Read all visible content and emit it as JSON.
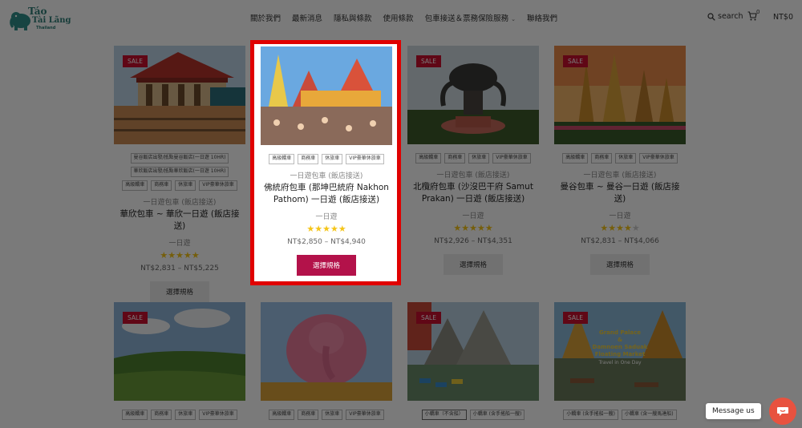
{
  "brand": {
    "line1": "Táo",
    "line1b": "Tài Lãng",
    "line2": "Thailand"
  },
  "nav": {
    "items": [
      "關於我們",
      "最新消息",
      "隱私與條款",
      "使用條款",
      "包車接送＆票務保險服務",
      "聯絡我們"
    ],
    "dropdown_index": 4
  },
  "header": {
    "search_label": "search",
    "cart_count": "0",
    "cart_total": "NT$0"
  },
  "sale_label": "SALE",
  "row1": [
    {
      "tags": [
        "曼谷飯店出發/抵點曼谷飯店(一日遊 10HR)",
        "華欣飯店出發/抵點華欣飯店(一日遊 10HR)",
        "高級轎車",
        "商務車",
        "休旅車",
        "VIP豪華休旅車"
      ],
      "category": "一日遊包車 (飯店接送)",
      "title": "華欣包車 ~ 華欣一日遊 (飯店接送)",
      "subtitle": "一日遊",
      "rating": 5,
      "price": "NT$2,831 – NT$5,225",
      "button": "選擇規格",
      "sale": true
    },
    {
      "tags": [
        "高級轎車",
        "商務車",
        "休旅車",
        "VIP豪華休旅車"
      ],
      "category": "一日遊包車 (飯店接送)",
      "title": "佛統府包車 (那坤巴統府 Nakhon Pathom) 一日遊 (飯店接送)",
      "subtitle": "一日遊",
      "rating": 5,
      "price": "NT$2,850 – NT$4,940",
      "button": "選擇規格",
      "sale": false
    },
    {
      "tags": [
        "高級轎車",
        "商務車",
        "休旅車",
        "VIP豪華休旅車"
      ],
      "category": "一日遊包車 (飯店接送)",
      "title": "北欖府包車 (沙沒巴干府 Samut Prakan) 一日遊 (飯店接送)",
      "subtitle": "一日遊",
      "rating": 5,
      "price": "NT$2,926 – NT$4,351",
      "button": "選擇規格",
      "sale": true
    },
    {
      "tags": [
        "高級轎車",
        "商務車",
        "休旅車",
        "VIP豪華休旅車"
      ],
      "category": "一日遊包車 (飯店接送)",
      "title": "曼谷包車 ~ 曼谷一日遊 (飯店接送)",
      "subtitle": "一日遊",
      "rating": 4,
      "price": "NT$2,831 – NT$4,066",
      "button": "選擇規格",
      "sale": true
    }
  ],
  "row2": [
    {
      "tags": [
        "高級轎車",
        "商務車",
        "休旅車",
        "VIP豪華休旅車"
      ],
      "sale": true
    },
    {
      "tags": [
        "高級轎車",
        "商務車",
        "休旅車",
        "VIP豪華休旅車"
      ],
      "sale": false
    },
    {
      "tags": [
        "小轎車（不含船）",
        "小轎車 (含手搖船一艘)"
      ],
      "sale": true
    },
    {
      "tags": [
        "小轎車 (含手搖船一艘)",
        "小轎車 (含一艘馬達船)"
      ],
      "sale": true,
      "poster": [
        "Grand Palace",
        "&",
        "Damnoen Saduak",
        "Floating Market",
        "Travel in One Day"
      ]
    }
  ],
  "chat": {
    "label": "Message us"
  }
}
